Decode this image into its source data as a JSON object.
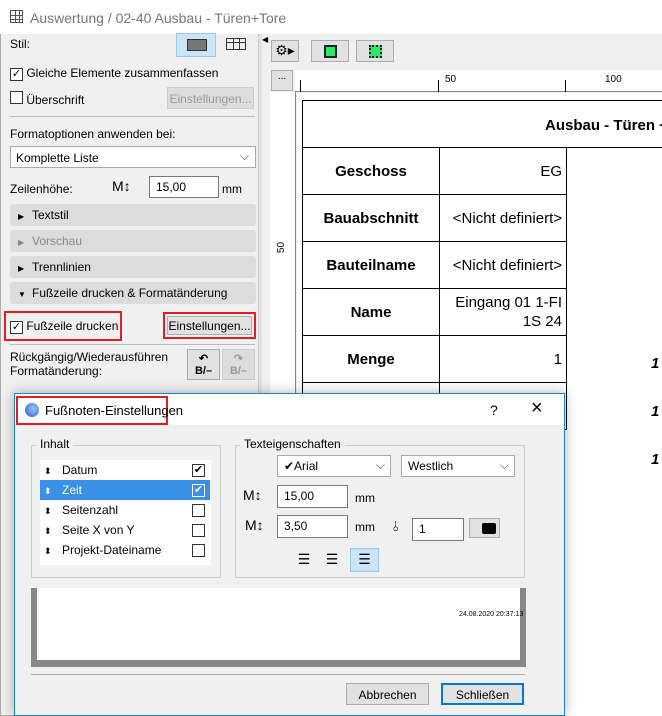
{
  "window": {
    "title": "Auswertung / 02-40 Ausbau - Türen+Tore"
  },
  "left_panel": {
    "stil_label": "Stil:",
    "gleiche_label": "Gleiche Elemente zusammenfassen",
    "gleiche_checked": true,
    "ueberschrift_label": "Überschrift",
    "ueberschrift_checked": false,
    "ueberschrift_button": "Einstellungen...",
    "formatoptionen_label": "Formatoptionen anwenden bei:",
    "formatoptionen_value": "Komplette Liste",
    "zeilenhoehe_label": "Zeilenhöhe:",
    "zeilenhoehe_value": "15,00",
    "zeilenhoehe_unit": "mm",
    "sections": [
      {
        "label": "Textstil",
        "expanded": false
      },
      {
        "label": "Vorschau",
        "expanded": false
      },
      {
        "label": "Trennlinien",
        "expanded": false
      },
      {
        "label": "Fußzeile drucken & Formatänderung",
        "expanded": true
      }
    ],
    "fusszeile_label": "Fußzeile drucken",
    "fusszeile_checked": true,
    "fusszeile_button": "Einstellungen...",
    "undo_label_1": "Rückgängig/Wiederausführen",
    "undo_label_2": "Formatänderung:"
  },
  "ruler": {
    "more": "...",
    "h_labels": [
      "50",
      "100"
    ],
    "v_labels": [
      "50"
    ]
  },
  "schedule": {
    "title": "Ausbau - Türen +",
    "rows": [
      {
        "header": "Geschoss",
        "value": "EG",
        "extra": ""
      },
      {
        "header": "Bauabschnitt",
        "value": "<Nicht definiert>",
        "extra": ""
      },
      {
        "header": "Bauteilname",
        "value": "<Nicht definiert>",
        "extra": ""
      },
      {
        "header": "Name",
        "value": "Eingang 01 1-FI 1S 24",
        "extra": ""
      },
      {
        "header": "Menge",
        "value": "1",
        "extra": "1"
      }
    ],
    "extra_values": [
      "1",
      "1"
    ]
  },
  "dialog": {
    "title": "Fußnoten-Einstellungen",
    "help": "?",
    "close": "×",
    "inhalt_label": "Inhalt",
    "items": [
      {
        "label": "Datum",
        "checked": true,
        "selected": false
      },
      {
        "label": "Zeit",
        "checked": true,
        "selected": true
      },
      {
        "label": "Seitenzahl",
        "checked": false,
        "selected": false
      },
      {
        "label": "Seite X von Y",
        "checked": false,
        "selected": false
      },
      {
        "label": "Projekt-Dateiname",
        "checked": false,
        "selected": false
      }
    ],
    "text_label": "Texteigenschaften",
    "font": "✔Arial",
    "script": "Westlich",
    "height_value": "15,00",
    "height_unit": "mm",
    "spacing_value": "3,50",
    "spacing_unit": "mm",
    "pen_value": "1",
    "alignment": "right",
    "preview_text": "24.08.2020 20:37:13",
    "cancel": "Abbrechen",
    "ok": "Schließen"
  }
}
